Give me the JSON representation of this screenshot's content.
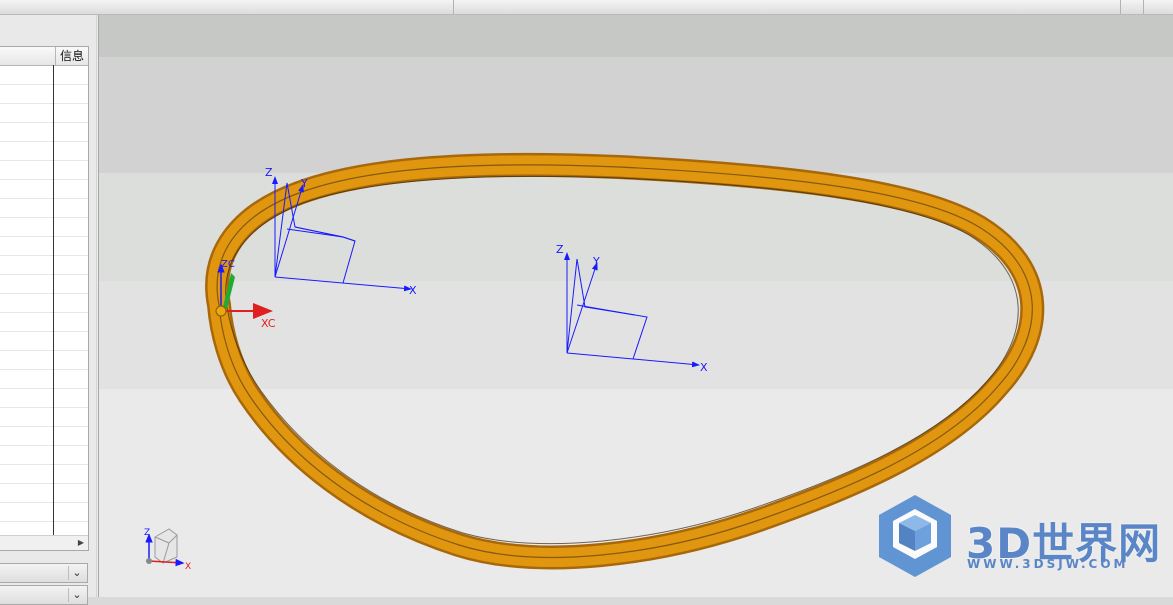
{
  "navigator": {
    "info_column": "信息",
    "row_count": 24
  },
  "viewport": {
    "csys_labels": {
      "z": "Z",
      "y": "Y",
      "x": "X",
      "zc": "ZC",
      "xc": "XC"
    },
    "triad": {
      "z": "Z",
      "x": "X"
    }
  },
  "watermark": {
    "brand": "3D世界网",
    "url": "WWW.3DSJW.COM"
  },
  "colors": {
    "ring": "#d8900f",
    "ring_dark": "#a8680a",
    "axes": "#1a1aff",
    "xc": "#e02020",
    "watermark": "#5a86c8"
  }
}
